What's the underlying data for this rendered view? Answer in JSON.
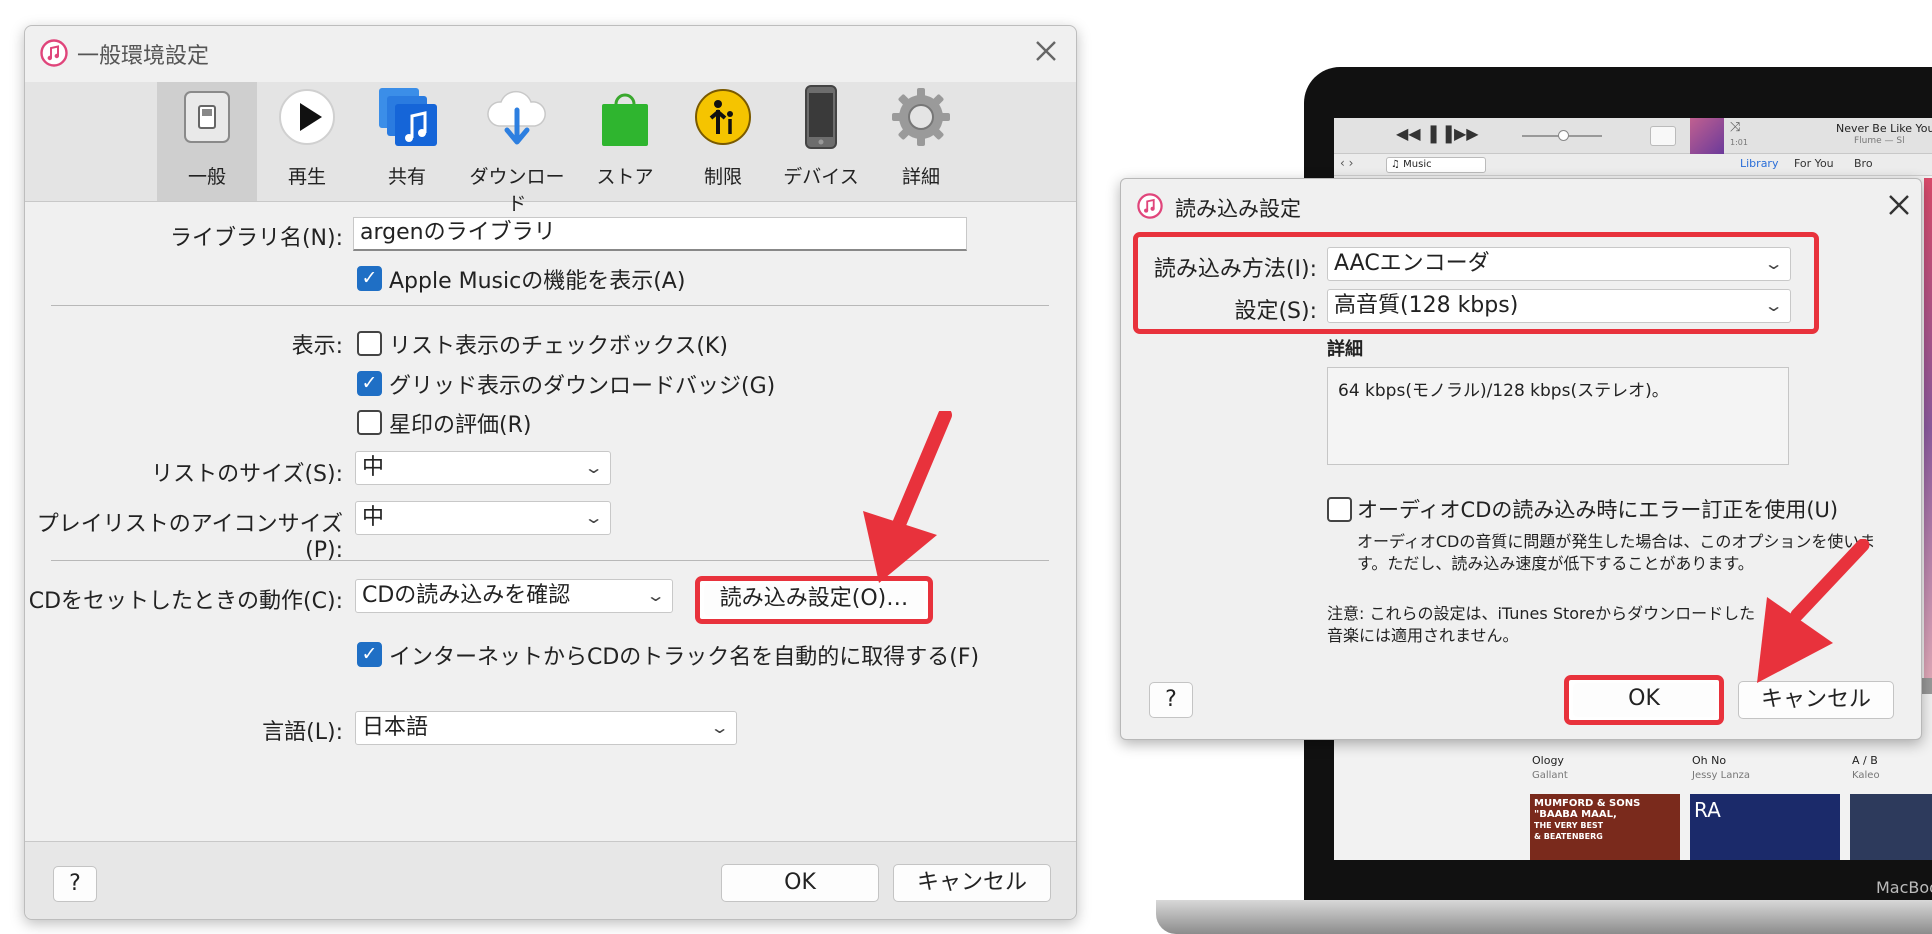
{
  "main_dialog": {
    "title": "一般環境設定",
    "toolbar": [
      {
        "label": "一般",
        "icon": "switch-icon"
      },
      {
        "label": "再生",
        "icon": "play-icon"
      },
      {
        "label": "共有",
        "icon": "share-music-icon"
      },
      {
        "label": "ダウンロード",
        "icon": "cloud-download-icon"
      },
      {
        "label": "ストア",
        "icon": "store-bag-icon"
      },
      {
        "label": "制限",
        "icon": "parental-restriction-icon"
      },
      {
        "label": "デバイス",
        "icon": "device-icon"
      },
      {
        "label": "詳細",
        "icon": "gear-icon"
      }
    ],
    "library_name_label": "ライブラリ名(N):",
    "library_name_value": "argenのライブラリ",
    "apple_music_label": "Apple Musicの機能を表示(A)",
    "display_label": "表示:",
    "list_checkbox_label": "リスト表示のチェックボックス(K)",
    "grid_badge_label": "グリッド表示のダウンロードバッジ(G)",
    "star_rating_label": "星印の評価(R)",
    "list_size_label": "リストのサイズ(S):",
    "list_size_value": "中",
    "playlist_icon_size_label": "プレイリストのアイコンサイズ(P):",
    "playlist_icon_size_value": "中",
    "cd_action_label": "CDをセットしたときの動作(C):",
    "cd_action_value": "CDの読み込みを確認",
    "import_settings_button": "読み込み設定(O)…",
    "auto_track_names_label": "インターネットからCDのトラック名を自動的に取得する(F)",
    "language_label": "言語(L):",
    "language_value": "日本語",
    "help_button": "?",
    "ok_button": "OK",
    "cancel_button": "キャンセル"
  },
  "import_dialog": {
    "title": "読み込み設定",
    "method_label": "読み込み方法(I):",
    "method_value": "AACエンコーダ",
    "setting_label": "設定(S):",
    "setting_value": "高音質(128 kbps)",
    "details_heading": "詳細",
    "details_text": "64 kbps(モノラル)/128 kbps(ステレオ)。",
    "error_correction_label": "オーディオCDの読み込み時にエラー訂正を使用(U)",
    "error_correction_note": "オーディオCDの音質に問題が発生した場合は、このオプションを使います。ただし、読み込み速度が低下することがあります。",
    "note": "注意: これらの設定は、iTunes Storeからダウンロードした音楽には適用されません。",
    "help_button": "?",
    "ok_button": "OK",
    "cancel_button": "キャンセル"
  },
  "laptop": {
    "now_playing_title": "Never Be Like You",
    "now_playing_artist": "Flume — Sl",
    "elapsed_time": "1:01",
    "source_select": "♫ Music",
    "tabs": [
      "Library",
      "For You",
      "Bro"
    ],
    "albums": [
      {
        "title": "Ology",
        "artist": "Gallant"
      },
      {
        "title": "Oh No",
        "artist": "Jessy Lanza"
      },
      {
        "title": "A / B",
        "artist": "Kaleo"
      }
    ],
    "album_art_text": [
      "MUMFORD & SONS",
      "\"BAABA MAAL,",
      "THE VERY BEST",
      "& BEATENBERG",
      "RA"
    ],
    "brand": "MacBoo"
  },
  "colors": {
    "highlight": "#e8323c",
    "accent": "#1f6fc5",
    "dialog_bg": "#f0f0f0",
    "toolbar_bg": "#e4e4e4"
  }
}
